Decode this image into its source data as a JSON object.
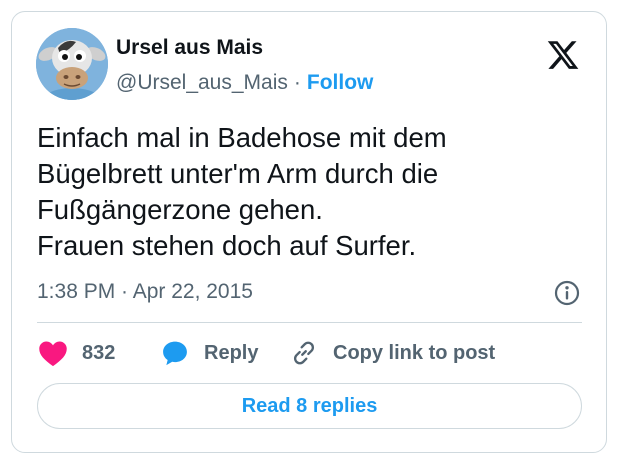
{
  "author": {
    "display_name": "Ursel aus Mais",
    "handle": "@Ursel_aus_Mais",
    "separator": "·",
    "follow_label": "Follow",
    "avatar_icon": "cartoon-cow-avatar"
  },
  "brand": {
    "logo_icon": "x-logo-icon",
    "logo_color": "#0f1419"
  },
  "tweet": {
    "lines": [
      "Einfach mal in Badehose mit dem",
      "Bügelbrett unter'm Arm durch die",
      "Fußgängerzone gehen.",
      "Frauen stehen doch auf Surfer."
    ],
    "timestamp": "1:38 PM · Apr 22, 2015",
    "info_icon": "info-icon"
  },
  "actions": {
    "like_count": "832",
    "like_icon": "heart-icon",
    "like_color": "#f91880",
    "reply_label": "Reply",
    "reply_icon": "speech-bubble-icon",
    "reply_color": "#1d9bf0",
    "copy_label": "Copy link to post",
    "copy_icon": "link-icon"
  },
  "read_replies": {
    "label": "Read 8 replies"
  },
  "colors": {
    "accent": "#1d9bf0",
    "text": "#0f1419",
    "secondary": "#536471",
    "border": "#cfd9de"
  }
}
